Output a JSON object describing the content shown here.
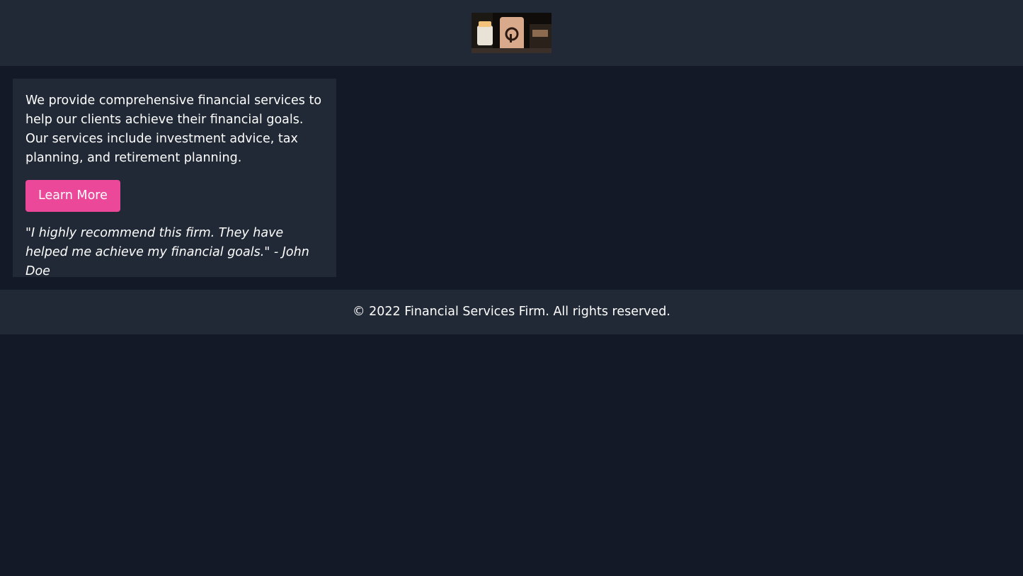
{
  "header": {
    "logo_icon": "product-photo-logo"
  },
  "services": {
    "description": "We provide comprehensive financial services to help our clients achieve their financial goals. Our services include investment advice, tax planning, and retirement planning.",
    "button_label": "Learn More",
    "testimonial": "\"I highly recommend this firm. They have helped me achieve my financial goals.\" - John Doe"
  },
  "footer": {
    "copyright": "© 2022 Financial Services Firm. All rights reserved."
  },
  "colors": {
    "page_background": "#131927",
    "panel_background": "#212936",
    "accent": "#ec4899",
    "text": "#ffffff"
  }
}
